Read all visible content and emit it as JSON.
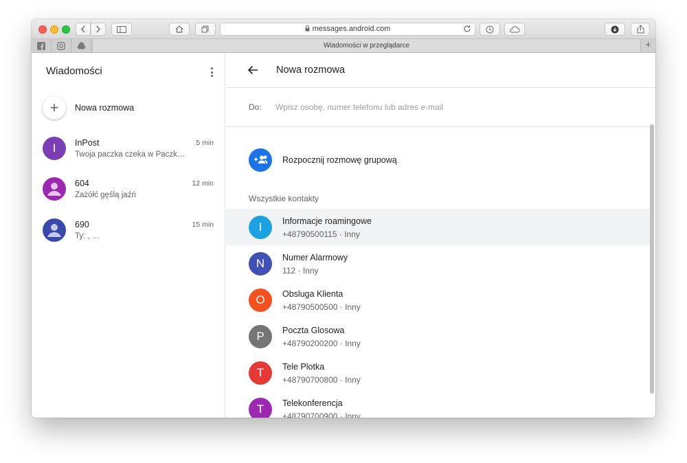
{
  "browser": {
    "url": "messages.android.com",
    "tab_title": "Wiadomości w przeglądarce",
    "tab_plus": "+",
    "icons": [
      "back-icon",
      "forward-icon",
      "sidebar-icon",
      "home-icon",
      "tabs-icon",
      "lock-icon",
      "reload-icon",
      "history-icon",
      "cloud-icon",
      "download-icon",
      "share-icon",
      "facebook-icon",
      "instagram-icon",
      "drive-icon"
    ]
  },
  "sidebar": {
    "title": "Wiadomości",
    "new_conversation": "Nowa rozmowa",
    "new_conversation_icon": "+",
    "conversations": [
      {
        "name": "InPost",
        "time": "5 min",
        "snippet": "Twoja paczka czeka w Paczk…",
        "avatar_letter": "I",
        "color": "#7b3fb5"
      },
      {
        "name": "604",
        "time": "12 min",
        "snippet": "Zażółć gęślą jaźń",
        "avatar_letter": "",
        "color": "#9c27b0"
      },
      {
        "name": "690",
        "time": "15 min",
        "snippet": "Ty:                              ,            …",
        "avatar_letter": "",
        "color": "#3949ab"
      }
    ]
  },
  "main": {
    "title": "Nowa rozmowa",
    "to_label": "Do:",
    "to_placeholder": "Wpisz osobę, numer telefonu lub adres e-mail",
    "group_label": "Rozpocznij rozmowę grupową",
    "section_title": "Wszystkie kontakty",
    "contacts": [
      {
        "name": "Informacje roamingowe",
        "number": "+48790500115",
        "type": "Inny",
        "letter": "I",
        "color": "#1aa3e0"
      },
      {
        "name": "Numer Alarmowy",
        "number": "112",
        "type": "Inny",
        "letter": "N",
        "color": "#3f51b5"
      },
      {
        "name": "Obsluga Klienta",
        "number": "+48790500500",
        "type": "Inny",
        "letter": "O",
        "color": "#f4511e"
      },
      {
        "name": "Poczta Glosowa",
        "number": "+48790200200",
        "type": "Inny",
        "letter": "P",
        "color": "#757575"
      },
      {
        "name": "Tele Plotka",
        "number": "+48790700800",
        "type": "Inny",
        "letter": "T",
        "color": "#e53935"
      },
      {
        "name": "Telekonferencja",
        "number": "+48790700900",
        "type": "Inny",
        "letter": "T",
        "color": "#9c27b0"
      }
    ],
    "separator": "·"
  }
}
